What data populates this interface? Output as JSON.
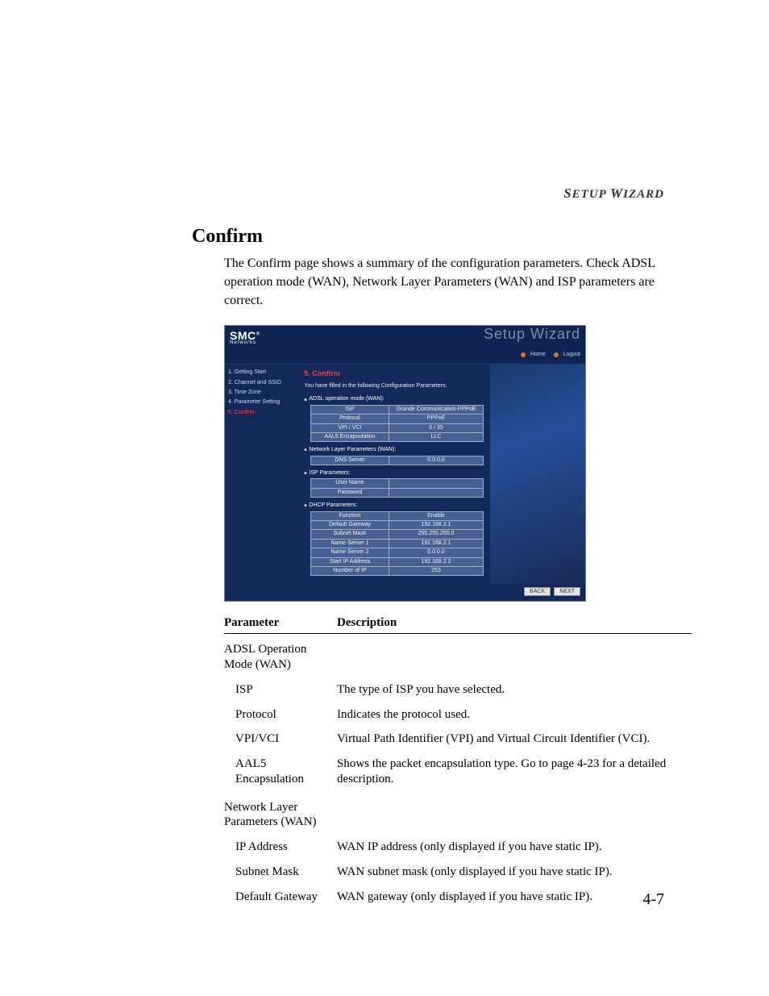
{
  "running_head": "Setup Wizard",
  "section_title": "Confirm",
  "intro": "The Confirm page shows a summary of the configuration parameters. Check ADSL operation mode (WAN), Network Layer Parameters (WAN) and ISP parameters are correct.",
  "screenshot": {
    "brand": "SMC",
    "brand_sub": "Networks",
    "wizard_label": "Setup Wizard",
    "topnav_home": "Home",
    "topnav_logout": "Logout",
    "side_items": [
      "1. Getting Start",
      "2. Channel and SSID",
      "3. Time Zone",
      "4. Parameter Setting",
      "5. Confirm"
    ],
    "side_active_index": 4,
    "main_title": "5. Confirm",
    "main_desc": "You have filled in the following Configuration Parameters:",
    "groups": [
      {
        "label": "ADSL operation mode (WAN):",
        "rows": [
          [
            "ISP",
            "Grande Communication-PPPoE"
          ],
          [
            "Protocol",
            "PPPoE"
          ],
          [
            "VPI / VCI",
            "0 / 35"
          ],
          [
            "AAL5 Encapsulation",
            "LLC"
          ]
        ]
      },
      {
        "label": "Network Layer Parameters (WAN):",
        "rows": [
          [
            "DNS Server",
            "0.0.0.0"
          ]
        ]
      },
      {
        "label": "ISP Parameters:",
        "rows": [
          [
            "User Name",
            ""
          ],
          [
            "Password",
            ""
          ]
        ]
      },
      {
        "label": "DHCP Parameters:",
        "rows": [
          [
            "Function",
            "Enable"
          ],
          [
            "Default Gateway",
            "192.168.2.1"
          ],
          [
            "Subnet Mask",
            "255.255.255.0"
          ],
          [
            "Name Server 1",
            "192.168.2.1"
          ],
          [
            "Name Server 2",
            "0.0.0.0"
          ],
          [
            "Start IP Address",
            "192.168.2.2"
          ],
          [
            "Number of IP",
            "253"
          ]
        ]
      }
    ],
    "back_label": "BACK",
    "next_label": "NEXT"
  },
  "doc_table": {
    "head_param": "Parameter",
    "head_desc": "Description",
    "rows": [
      {
        "param": "ADSL Operation Mode (WAN)",
        "desc": "",
        "is_header": true
      },
      {
        "param": "ISP",
        "desc": "The type of ISP you have selected.",
        "indent": true
      },
      {
        "param": "Protocol",
        "desc": "Indicates the protocol used.",
        "indent": true
      },
      {
        "param": "VPI/VCI",
        "desc": "Virtual Path Identifier (VPI) and Virtual Circuit Identifier (VCI).",
        "indent": true
      },
      {
        "param": "AAL5 Encapsulation",
        "desc": "Shows the packet encapsulation type. Go to  page 4-23 for a detailed description.",
        "indent": true
      },
      {
        "param": "Network Layer Parameters (WAN)",
        "desc": "",
        "is_header": true
      },
      {
        "param": "IP Address",
        "desc": "WAN IP address (only displayed if you have static IP).",
        "indent": true
      },
      {
        "param": "Subnet Mask",
        "desc": "WAN subnet mask (only displayed if you have static IP).",
        "indent": true
      },
      {
        "param": "Default Gateway",
        "desc": "WAN gateway (only displayed if you have static IP).",
        "indent": true
      }
    ]
  },
  "page_number": "4-7"
}
